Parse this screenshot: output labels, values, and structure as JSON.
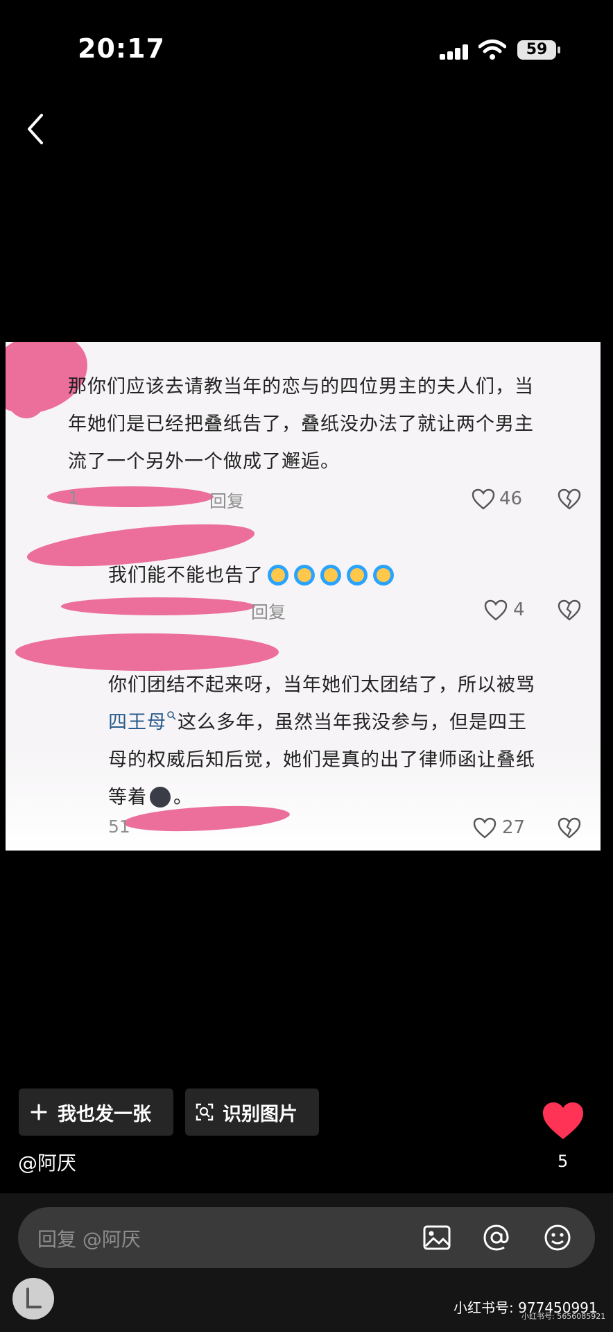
{
  "status": {
    "time": "20:17",
    "battery": "59"
  },
  "comments": [
    {
      "text_lines": [
        "那你们应该去请教当年的恋与的四位男主的夫人们，当",
        "年她们是已经把叠纸告了，叠纸没办法了就让两个男主",
        "流了一个另外一个做成了邂逅。"
      ],
      "meta_left": "1",
      "reply_label": "回复",
      "likes": "46"
    },
    {
      "text": "我们能不能也告了",
      "reply_label": "回复",
      "likes": "4"
    },
    {
      "line1": "你们团结不起来呀，当年她们太团结了，所以被骂",
      "line2_link": "四王母",
      "line2_rest": "这么多年，虽然当年我没参与，但是四王",
      "line3": "母的权威后知后觉，她们是真的出了律师函让叠纸",
      "line4_a": "等着",
      "line4_b": "。",
      "meta_left": "51",
      "likes": "27"
    }
  ],
  "buttons": {
    "post_same": "我也发一张",
    "recognize": "识别图片"
  },
  "author": "@阿厌",
  "like_count": "5",
  "reply_placeholder": "回复 @阿厌",
  "watermark": {
    "line1": "小红书号: 977450991",
    "line2": "小红书号: 5656085921"
  },
  "colors": {
    "heart": "#ff3355",
    "link": "#2a5d8d",
    "redaction": "#ec6f9b"
  }
}
